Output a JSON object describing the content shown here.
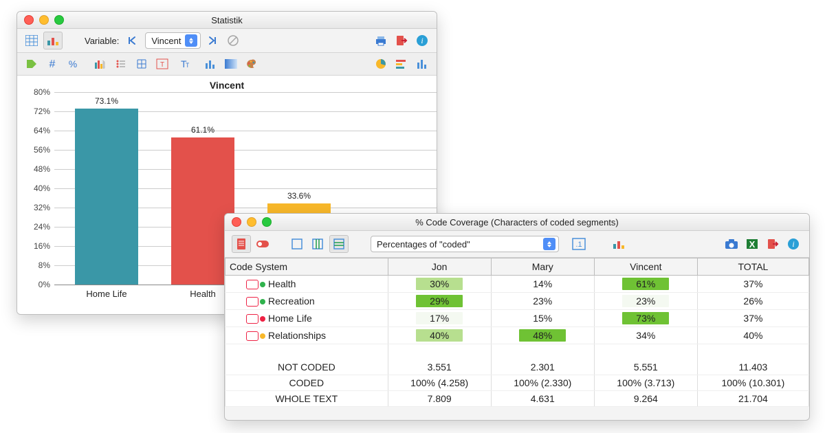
{
  "win1": {
    "title": "Statistik",
    "variable_label": "Variable:",
    "variable_value": "Vincent"
  },
  "chart_data": {
    "type": "bar",
    "title": "Vincent",
    "ylabel": "",
    "xlabel": "",
    "ylim": [
      0,
      80
    ],
    "ytick_step": 8,
    "yticks": [
      "80%",
      "72%",
      "64%",
      "56%",
      "48%",
      "40%",
      "32%",
      "24%",
      "16%",
      "8%",
      "0%"
    ],
    "categories": [
      "Home Life",
      "Health",
      ""
    ],
    "values": [
      73.1,
      61.1,
      33.6
    ],
    "value_labels": [
      "73.1%",
      "61.1%",
      "33.6%"
    ],
    "colors": [
      "#3a97a7",
      "#e3514b",
      "#f8b82a"
    ]
  },
  "win2": {
    "title": "% Code Coverage (Characters of coded segments)",
    "select_label": "Percentages of \"coded\"",
    "table": {
      "head": [
        "Code System",
        "Jon",
        "Mary",
        "Vincent",
        "TOTAL"
      ],
      "rows": [
        {
          "label": "Health",
          "dot": "#2fb24c",
          "cells": [
            {
              "v": "30%",
              "s": 2
            },
            {
              "v": "14%",
              "s": null
            },
            {
              "v": "61%",
              "s": 3
            },
            {
              "v": "37%",
              "s": null
            }
          ]
        },
        {
          "label": "Recreation",
          "dot": "#2fb24c",
          "cells": [
            {
              "v": "29%",
              "s": 3
            },
            {
              "v": "23%",
              "s": null
            },
            {
              "v": "23%",
              "s": 0
            },
            {
              "v": "26%",
              "s": null
            }
          ]
        },
        {
          "label": "Home Life",
          "dot": "#e24",
          "cells": [
            {
              "v": "17%",
              "s": 0
            },
            {
              "v": "15%",
              "s": null
            },
            {
              "v": "73%",
              "s": 3
            },
            {
              "v": "37%",
              "s": null
            }
          ]
        },
        {
          "label": "Relationships",
          "dot": "#f8b82a",
          "cells": [
            {
              "v": "40%",
              "s": 2
            },
            {
              "v": "48%",
              "s": 3
            },
            {
              "v": "34%",
              "s": null
            },
            {
              "v": "40%",
              "s": null
            }
          ]
        }
      ],
      "summary": [
        {
          "label": "NOT CODED",
          "cells": [
            "3.551",
            "2.301",
            "5.551",
            "11.403"
          ]
        },
        {
          "label": "CODED",
          "cells": [
            "100% (4.258)",
            "100% (2.330)",
            "100% (3.713)",
            "100% (10.301)"
          ]
        },
        {
          "label": "WHOLE TEXT",
          "cells": [
            "7.809",
            "4.631",
            "9.264",
            "21.704"
          ]
        }
      ]
    }
  }
}
